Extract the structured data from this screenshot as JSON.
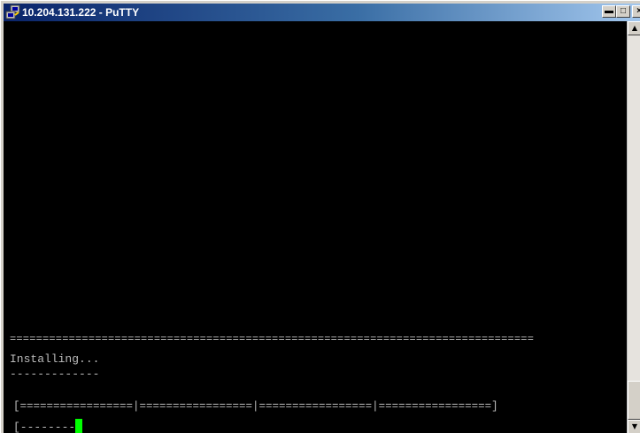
{
  "window": {
    "title": "10.204.131.222 - PuTTY",
    "app_icon": "putty-icon",
    "controls": {
      "minimize_icon": "minimize-icon",
      "maximize_icon": "maximize-icon",
      "close_icon": "close-icon"
    }
  },
  "terminal": {
    "separator": "================================================================================",
    "status": "Installing...",
    "status_underline": "-------------",
    "progress_scale": "[=================|=================|=================|=================]",
    "progress_bar": "[--------",
    "cursor_color": "#00ff00",
    "text_color": "#bbbbbb",
    "background_color": "#000000"
  },
  "colors": {
    "titlebar_start": "#0a246a",
    "titlebar_end": "#a6caf0"
  }
}
